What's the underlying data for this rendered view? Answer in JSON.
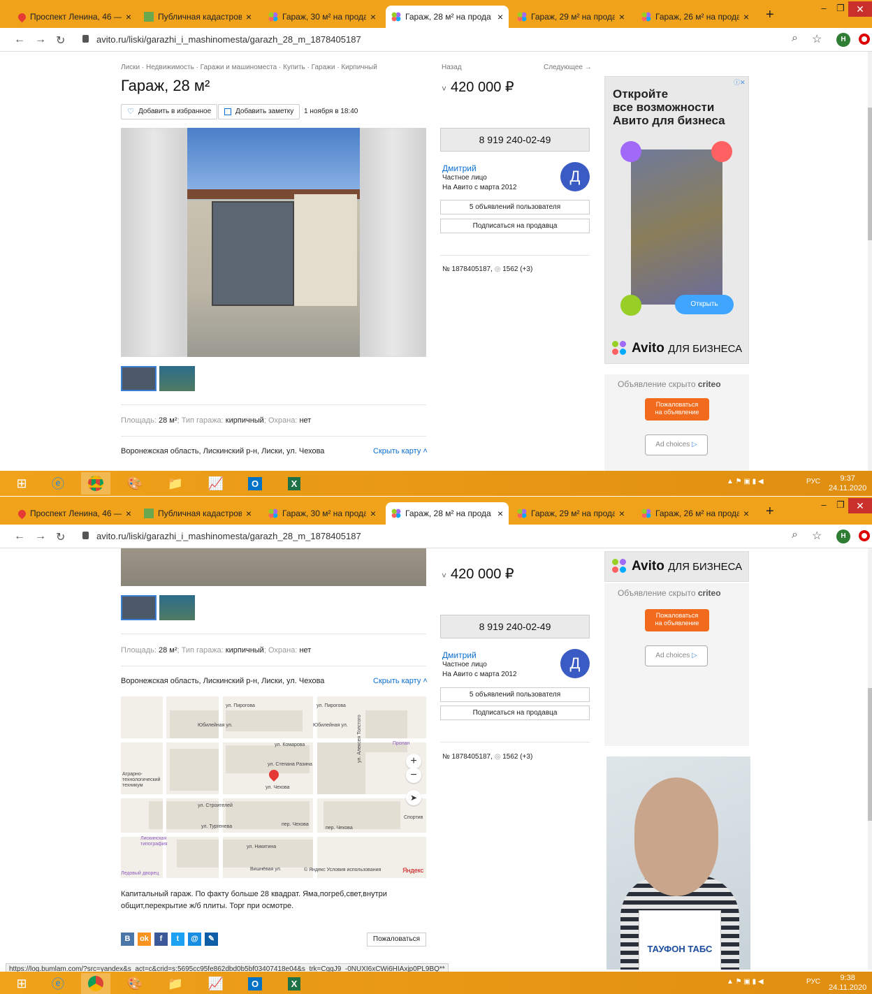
{
  "tabs": [
    {
      "title": "Проспект Ленина, 46 —"
    },
    {
      "title": "Публичная кадастрова"
    },
    {
      "title": "Гараж, 30 м² на прода"
    },
    {
      "title": "Гараж, 28 м² на прода"
    },
    {
      "title": "Гараж, 29 м² на прода"
    },
    {
      "title": "Гараж, 26 м² на прода"
    }
  ],
  "tab_close": "×",
  "new_tab": "+",
  "address_bar": {
    "url": "avito.ru/liski/garazhi_i_mashinomesta/garazh_28_m_1878405187",
    "profile_initial": "Н"
  },
  "breadcrumb": "Лиски · Недвижимость · Гаражи и машиноместа · Купить · Гаражи · Кирпичный",
  "listing": {
    "title": "Гараж, 28 м²",
    "add_favorite": "Добавить в избранное",
    "add_note": "Добавить заметку",
    "date": "1 ноября в 18:40",
    "params": {
      "area_label": "Площадь:",
      "area_value": "28 м²",
      "type_label": "Тип гаража:",
      "type_value": "кирпичный",
      "guard_label": "Охрана:",
      "guard_value": "нет"
    },
    "address": "Воронежская область, Лискинский р-н, Лиски, ул. Чехова",
    "hide_map": "Скрыть карту",
    "description_line1": "Капитальный гараж. По факту больше 28 квадрат. Яма,погреб,свет,внутри",
    "description_line2": "общит,перекрытие ж/б плиты. Торг при осмотре.",
    "complain": "Пожаловаться"
  },
  "sidebar": {
    "back": "Назад",
    "next": "Следующее →",
    "price": "420 000 ₽",
    "phone": "8 919 240-02-49",
    "seller_name": "Дмитрий",
    "seller_type": "Частное лицо",
    "seller_since": "На Авито с марта 2012",
    "seller_initial": "Д",
    "user_ads": "5 объявлений пользователя",
    "subscribe": "Подписаться на продавца",
    "listing_number": "№ 1878405187,",
    "views": "1562 (+3)"
  },
  "ad_avito": {
    "line1": "Откройте",
    "line2": "все возможности",
    "line3": "Авито для бизнеса",
    "open": "Открыть",
    "logo": "Avito",
    "logo_suffix": "ДЛЯ БИЗНЕСА"
  },
  "criteo": {
    "hidden": "Объявление скрыто",
    "brand": "criteo",
    "complain_line1": "Пожаловаться",
    "complain_line2": "на объявление",
    "ad_choices": "Ad choices"
  },
  "ad_pharma": {
    "brand": "ТАУФОН ТАБС"
  },
  "map_labels": {
    "street1": "ул. Пирогова",
    "street2": "ул. Пирогова",
    "street3": "Юбилейная ул.",
    "street4": "Юбилейная ул.",
    "street5": "ул. Комарова",
    "street6": "ул. Степана Разина",
    "street7": "ул. Чехова",
    "street8": "ул. Строителей",
    "street9": "ул. Тургенева",
    "street10": "пер. Чехова",
    "street11": "пер. Чехова",
    "street12": "ул. Никитина",
    "street13": "Вишнёвая ул.",
    "street14": "ул. Алексея Толстого",
    "poi1": "Аграрно-технологический техникум",
    "poi2": "Лискинская типография",
    "poi3": "Пропан",
    "poi4": "Спортив",
    "poi5": "Ледовый дворец",
    "credit": "© Яндекс Условия использования",
    "yandex": "Яндекс",
    "zoom_in": "+",
    "zoom_out": "−"
  },
  "status_url": "https://log.bumlam.com/?src=yandex&s_act=c&crid=s:5695cc95fe862dbd0b5bf03407418e04&s_trk=CggJ9_-0NUXI6xCWi6HIAxjp0PL9BQ**",
  "taskbar": {
    "lang": "РУС",
    "time1": "9:37",
    "date1": "24.11.2020",
    "time2": "9:38",
    "date2": "24.11.2020"
  },
  "colors": {
    "tabbar": "#f0a21a",
    "link": "#0a6ed1",
    "avatar": "#3b5bc4",
    "complain": "#f26a1b"
  }
}
